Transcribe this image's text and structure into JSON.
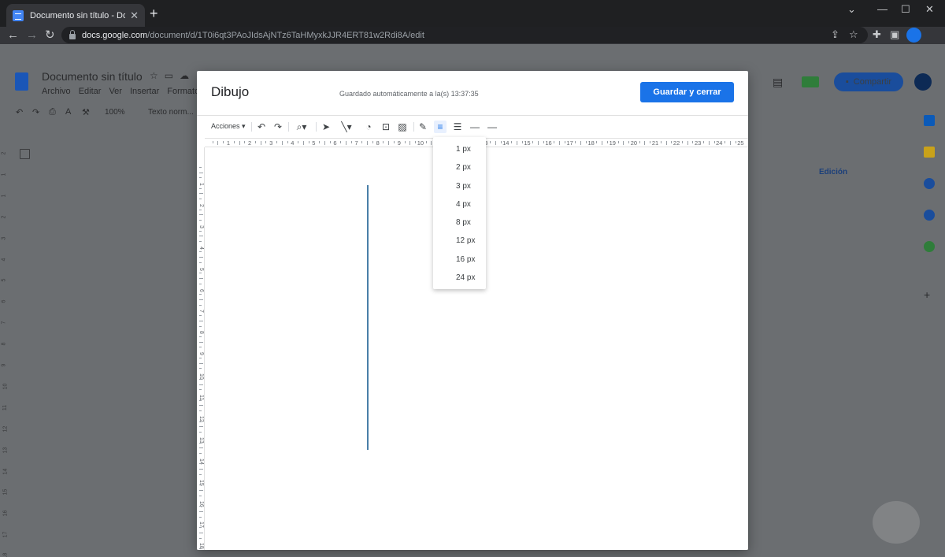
{
  "browser": {
    "tab_title": "Documento sin título - Docume",
    "url_host": "docs.google.com",
    "url_path": "/document/d/1T0i6qt3PAoJIdsAjNTz6TaHMyxkJJR4ERT81w2Rdi8A/edit"
  },
  "docs": {
    "title": "Documento sin título",
    "menu": [
      "Archivo",
      "Editar",
      "Ver",
      "Insertar",
      "Formato"
    ],
    "zoom": "100%",
    "style": "Texto norm...",
    "share_label": "Compartir",
    "mode_label": "Edición",
    "left_ruler": [
      "2",
      "1",
      "1",
      "2",
      "3",
      "4",
      "5",
      "6",
      "7",
      "8",
      "9",
      "10",
      "11",
      "12",
      "13",
      "14",
      "15",
      "16",
      "17",
      "18",
      "19"
    ]
  },
  "dialog": {
    "title": "Dibujo",
    "saved_status": "Guardado automáticamente a la(s) 13:37:35",
    "save_button": "Guardar y cerrar",
    "actions_label": "Acciones",
    "h_ruler": [
      "1",
      "2",
      "3",
      "4",
      "5",
      "6",
      "7",
      "8",
      "9",
      "10",
      "11",
      "12",
      "13",
      "14",
      "15",
      "16",
      "17",
      "18",
      "19",
      "20",
      "21",
      "22",
      "23",
      "24",
      "25"
    ],
    "v_ruler": [
      "1",
      "2",
      "3",
      "4",
      "5",
      "6",
      "7",
      "8",
      "9",
      "10",
      "11",
      "12",
      "13",
      "14",
      "15",
      "16",
      "17",
      "18",
      "19"
    ],
    "line_weight_menu": [
      "1 px",
      "2 px",
      "3 px",
      "4 px",
      "8 px",
      "12 px",
      "16 px",
      "24 px"
    ]
  },
  "colors": {
    "primary_button": "#1a73e8",
    "drawn_line": "#4a7fa8"
  }
}
